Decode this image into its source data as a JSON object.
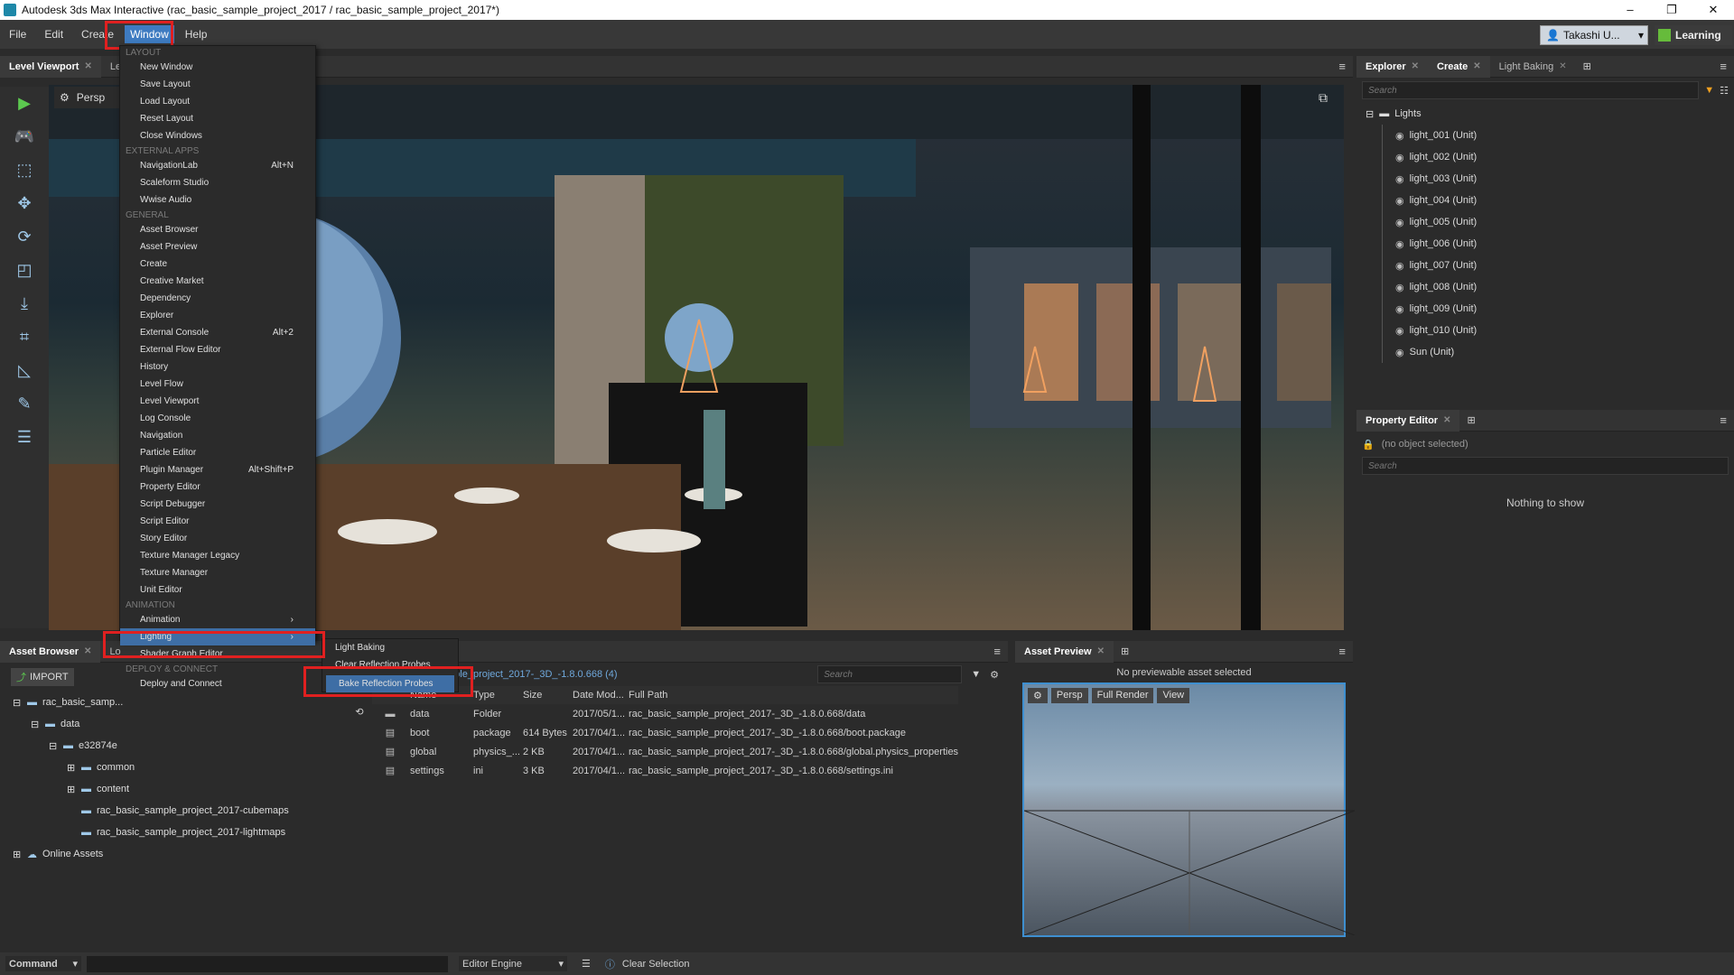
{
  "window": {
    "title": "Autodesk 3ds Max Interactive (rac_basic_sample_project_2017 / rac_basic_sample_project_2017*)",
    "controls": [
      "–",
      "❐",
      "✕"
    ]
  },
  "menubar": {
    "items": [
      "File",
      "Edit",
      "Create",
      "Window",
      "Help"
    ],
    "active": "Window",
    "user": "Takashi U...",
    "learning": "Learning"
  },
  "viewport_tabs": [
    "Level Viewport",
    "Le"
  ],
  "viewport": {
    "camera": "Persp"
  },
  "window_menu": {
    "sections": [
      {
        "label": "LAYOUT",
        "items": [
          {
            "label": "New Window",
            "shortcut": ""
          },
          {
            "label": "Save Layout",
            "shortcut": ""
          },
          {
            "label": "Load Layout",
            "shortcut": ""
          },
          {
            "label": "Reset Layout",
            "shortcut": ""
          },
          {
            "label": "Close Windows",
            "shortcut": ""
          }
        ]
      },
      {
        "label": "EXTERNAL APPS",
        "items": [
          {
            "label": "NavigationLab",
            "shortcut": "Alt+N"
          },
          {
            "label": "Scaleform Studio",
            "shortcut": ""
          },
          {
            "label": "Wwise Audio",
            "shortcut": ""
          }
        ]
      },
      {
        "label": "GENERAL",
        "items": [
          {
            "label": "Asset Browser",
            "shortcut": ""
          },
          {
            "label": "Asset Preview",
            "shortcut": ""
          },
          {
            "label": "Create",
            "shortcut": ""
          },
          {
            "label": "Creative Market",
            "shortcut": ""
          },
          {
            "label": "Dependency",
            "shortcut": ""
          },
          {
            "label": "Explorer",
            "shortcut": ""
          },
          {
            "label": "External Console",
            "shortcut": "Alt+2"
          },
          {
            "label": "External Flow Editor",
            "shortcut": ""
          },
          {
            "label": "History",
            "shortcut": ""
          },
          {
            "label": "Level Flow",
            "shortcut": ""
          },
          {
            "label": "Level Viewport",
            "shortcut": ""
          },
          {
            "label": "Log Console",
            "shortcut": ""
          },
          {
            "label": "Navigation",
            "shortcut": ""
          },
          {
            "label": "Particle Editor",
            "shortcut": ""
          },
          {
            "label": "Plugin Manager",
            "shortcut": "Alt+Shift+P"
          },
          {
            "label": "Property Editor",
            "shortcut": ""
          },
          {
            "label": "Script Debugger",
            "shortcut": ""
          },
          {
            "label": "Script Editor",
            "shortcut": ""
          },
          {
            "label": "Story Editor",
            "shortcut": ""
          },
          {
            "label": "Texture Manager Legacy",
            "shortcut": ""
          },
          {
            "label": "Texture Manager",
            "shortcut": ""
          },
          {
            "label": "Unit Editor",
            "shortcut": ""
          }
        ]
      },
      {
        "label": "ANIMATION",
        "items": [
          {
            "label": "Animation",
            "shortcut": "›"
          }
        ]
      }
    ],
    "lighting": "Lighting",
    "lighting_arrow": "›",
    "shader_graph": "Shader Graph Editor",
    "deploy_section": "DEPLOY & CONNECT",
    "deploy_item": "Deploy and Connect"
  },
  "lighting_submenu": {
    "items": [
      "Light Baking",
      "Clear Reflection Probes",
      "Bake Reflection Probes"
    ],
    "highlighted": "Bake Reflection Probes"
  },
  "explorer": {
    "tabs": [
      "Explorer",
      "Create",
      "Light Baking"
    ],
    "search_placeholder": "Search",
    "root": "Lights",
    "items": [
      "light_001 (Unit)",
      "light_002 (Unit)",
      "light_003 (Unit)",
      "light_004 (Unit)",
      "light_005 (Unit)",
      "light_006 (Unit)",
      "light_007 (Unit)",
      "light_008 (Unit)",
      "light_009 (Unit)",
      "light_010 (Unit)",
      "Sun (Unit)"
    ]
  },
  "property_editor": {
    "tab": "Property Editor",
    "selection": "(no object selected)",
    "search_placeholder": "Search",
    "empty": "Nothing to show"
  },
  "asset_browser": {
    "tabs": [
      "Asset Browser",
      "Lo"
    ],
    "import": "IMPORT",
    "tree": [
      {
        "label": "rac_basic_samp...",
        "depth": 0
      },
      {
        "label": "data",
        "depth": 1
      },
      {
        "label": "e32874e",
        "depth": 2
      },
      {
        "label": "common",
        "depth": 3
      },
      {
        "label": "content",
        "depth": 3
      },
      {
        "label": "rac_basic_sample_project_2017-cubemaps",
        "depth": 3
      },
      {
        "label": "rac_basic_sample_project_2017-lightmaps",
        "depth": 3
      },
      {
        "label": "Online Assets",
        "depth": 0
      }
    ]
  },
  "file_panel": {
    "path": "...ple_project_2017-_3D_-1.8.0.668 (4)",
    "search_placeholder": "Search",
    "columns": [
      "Name",
      "Type",
      "Size",
      "Date Mod...",
      "Full Path"
    ],
    "rows": [
      [
        "data",
        "Folder",
        "",
        "2017/05/1...",
        "rac_basic_sample_project_2017-_3D_-1.8.0.668/data"
      ],
      [
        "boot",
        "package",
        "614 Bytes",
        "2017/04/1...",
        "rac_basic_sample_project_2017-_3D_-1.8.0.668/boot.package"
      ],
      [
        "global",
        "physics_...",
        "2 KB",
        "2017/04/1...",
        "rac_basic_sample_project_2017-_3D_-1.8.0.668/global.physics_properties"
      ],
      [
        "settings",
        "ini",
        "3 KB",
        "2017/04/1...",
        "rac_basic_sample_project_2017-_3D_-1.8.0.668/settings.ini"
      ]
    ]
  },
  "asset_preview": {
    "tab": "Asset Preview",
    "message": "No previewable asset selected",
    "camera": "Persp",
    "render": "Full Render",
    "view": "View"
  },
  "statusbar": {
    "command": "Command",
    "engine": "Editor Engine",
    "clear": "Clear Selection"
  }
}
